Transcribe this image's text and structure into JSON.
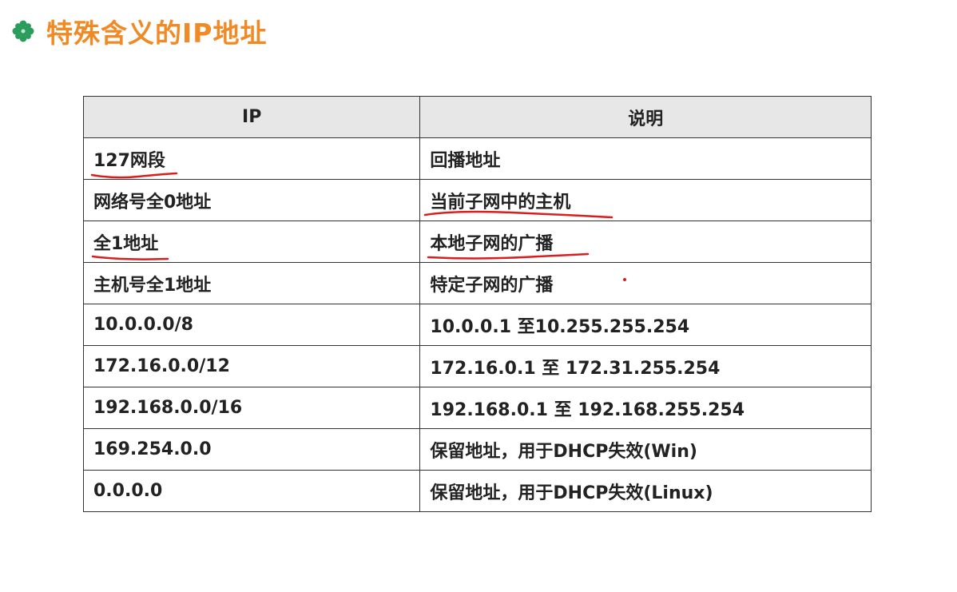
{
  "title": "特殊含义的IP地址",
  "colors": {
    "title": "#f08a24",
    "bullet": "#2a9d5c",
    "annotation": "#d81e1e",
    "header_bg": "#e7e7e7"
  },
  "table": {
    "headers": [
      "IP",
      "说明"
    ],
    "rows": [
      [
        "127网段",
        "回播地址"
      ],
      [
        "网络号全0地址",
        "当前子网中的主机"
      ],
      [
        "全1地址",
        "本地子网的广播"
      ],
      [
        "主机号全1地址",
        "特定子网的广播"
      ],
      [
        "10.0.0.0/8",
        "10.0.0.1 至10.255.255.254"
      ],
      [
        "172.16.0.0/12",
        "172.16.0.1 至 172.31.255.254"
      ],
      [
        "192.168.0.0/16",
        "192.168.0.1 至 192.168.255.254"
      ],
      [
        "169.254.0.0",
        "保留地址，用于DHCP失效(Win)"
      ],
      [
        "0.0.0.0",
        "保留地址，用于DHCP失效(Linux)"
      ]
    ]
  }
}
